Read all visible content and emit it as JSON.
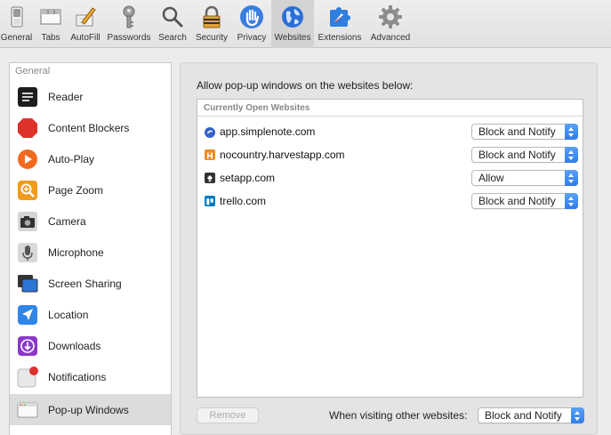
{
  "toolbar": {
    "items": [
      {
        "label": "General",
        "icon": "switch-icon"
      },
      {
        "label": "Tabs",
        "icon": "tabs-icon"
      },
      {
        "label": "AutoFill",
        "icon": "pencil-icon"
      },
      {
        "label": "Passwords",
        "icon": "key-icon"
      },
      {
        "label": "Search",
        "icon": "magnifier-icon"
      },
      {
        "label": "Security",
        "icon": "lock-icon"
      },
      {
        "label": "Privacy",
        "icon": "hand-icon"
      },
      {
        "label": "Websites",
        "icon": "globe-icon",
        "active": true
      },
      {
        "label": "Extensions",
        "icon": "puzzle-icon"
      },
      {
        "label": "Advanced",
        "icon": "gear-icon"
      }
    ]
  },
  "sidebar": {
    "header": "General",
    "items": [
      {
        "label": "Reader",
        "icon": "reader-icon"
      },
      {
        "label": "Content Blockers",
        "icon": "stop-icon"
      },
      {
        "label": "Auto-Play",
        "icon": "play-icon"
      },
      {
        "label": "Page Zoom",
        "icon": "zoom-icon"
      },
      {
        "label": "Camera",
        "icon": "camera-icon"
      },
      {
        "label": "Microphone",
        "icon": "microphone-icon"
      },
      {
        "label": "Screen Sharing",
        "icon": "screen-sharing-icon"
      },
      {
        "label": "Location",
        "icon": "location-arrow-icon"
      },
      {
        "label": "Downloads",
        "icon": "download-icon"
      },
      {
        "label": "Notifications",
        "icon": "notification-badge-icon"
      },
      {
        "label": "Pop-up Windows",
        "icon": "popup-window-icon",
        "selected": true
      }
    ]
  },
  "main": {
    "title": "Allow pop-up windows on the websites below:",
    "table_header": "Currently Open Websites",
    "rows": [
      {
        "site": "app.simplenote.com",
        "setting": "Block and Notify",
        "icon": "simplenote-icon",
        "color": "#3361cc"
      },
      {
        "site": "nocountry.harvestapp.com",
        "setting": "Block and Notify",
        "icon": "harvest-icon",
        "color": "#f08b1d"
      },
      {
        "site": "setapp.com",
        "setting": "Allow",
        "icon": "setapp-icon",
        "color": "#333333"
      },
      {
        "site": "trello.com",
        "setting": "Block and Notify",
        "icon": "trello-icon",
        "color": "#0079bf"
      }
    ],
    "remove_label": "Remove",
    "other_label": "When visiting other websites:",
    "other_setting": "Block and Notify"
  },
  "colors": {
    "accent": "#2f7ce8",
    "selection": "#dcdcdc"
  }
}
